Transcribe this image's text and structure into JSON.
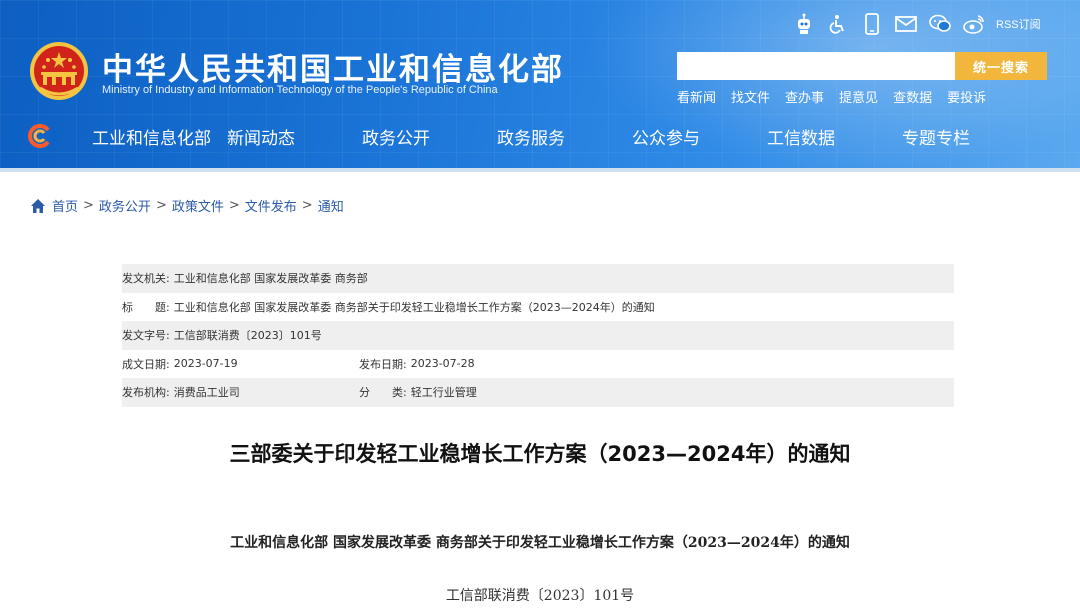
{
  "header": {
    "title": "中华人民共和国工业和信息化部",
    "subtitle": "Ministry of Industry and Information Technology of the People's Republic of China",
    "icons": [
      "robot-icon",
      "accessibility-icon",
      "mobile-icon",
      "mail-icon",
      "wechat-icon",
      "weibo-icon"
    ],
    "rss_label": "RSS订阅",
    "search": {
      "placeholder": "",
      "button_label": "统一搜索"
    },
    "quick_links": [
      "看新闻",
      "找文件",
      "查办事",
      "提意见",
      "查数据",
      "要投诉"
    ]
  },
  "nav": {
    "items": [
      "工业和信息化部",
      "新闻动态",
      "政务公开",
      "政务服务",
      "公众参与",
      "工信数据",
      "专题专栏"
    ]
  },
  "breadcrumb": {
    "items": [
      "首页",
      "政务公开",
      "政策文件",
      "文件发布",
      "通知"
    ],
    "separator": ">"
  },
  "meta": {
    "issuer_label": "发文机关:",
    "issuer": "工业和信息化部 国家发展改革委 商务部",
    "title_label": "标　　题:",
    "title": "工业和信息化部 国家发展改革委 商务部关于印发轻工业稳增长工作方案（2023—2024年）的通知",
    "doc_no_label": "发文字号:",
    "doc_no": "工信部联消费〔2023〕101号",
    "created_label": "成文日期:",
    "created": "2023-07-19",
    "published_label": "发布日期:",
    "published": "2023-07-28",
    "org_label": "发布机构:",
    "org": "消费品工业司",
    "category_label": "分　　类:",
    "category": "轻工行业管理"
  },
  "article": {
    "title": "三部委关于印发轻工业稳增长工作方案（2023—2024年）的通知",
    "heading": "工业和信息化部  国家发展改革委  商务部关于印发轻工业稳增长工作方案（2023—2024年）的通知",
    "number": "工信部联消费〔2023〕101号"
  },
  "colors": {
    "header_blue": "#1a73d6",
    "search_button": "#f2b63c",
    "breadcrumb_link": "#2a5aa8",
    "meta_stripe": "#efefef"
  }
}
